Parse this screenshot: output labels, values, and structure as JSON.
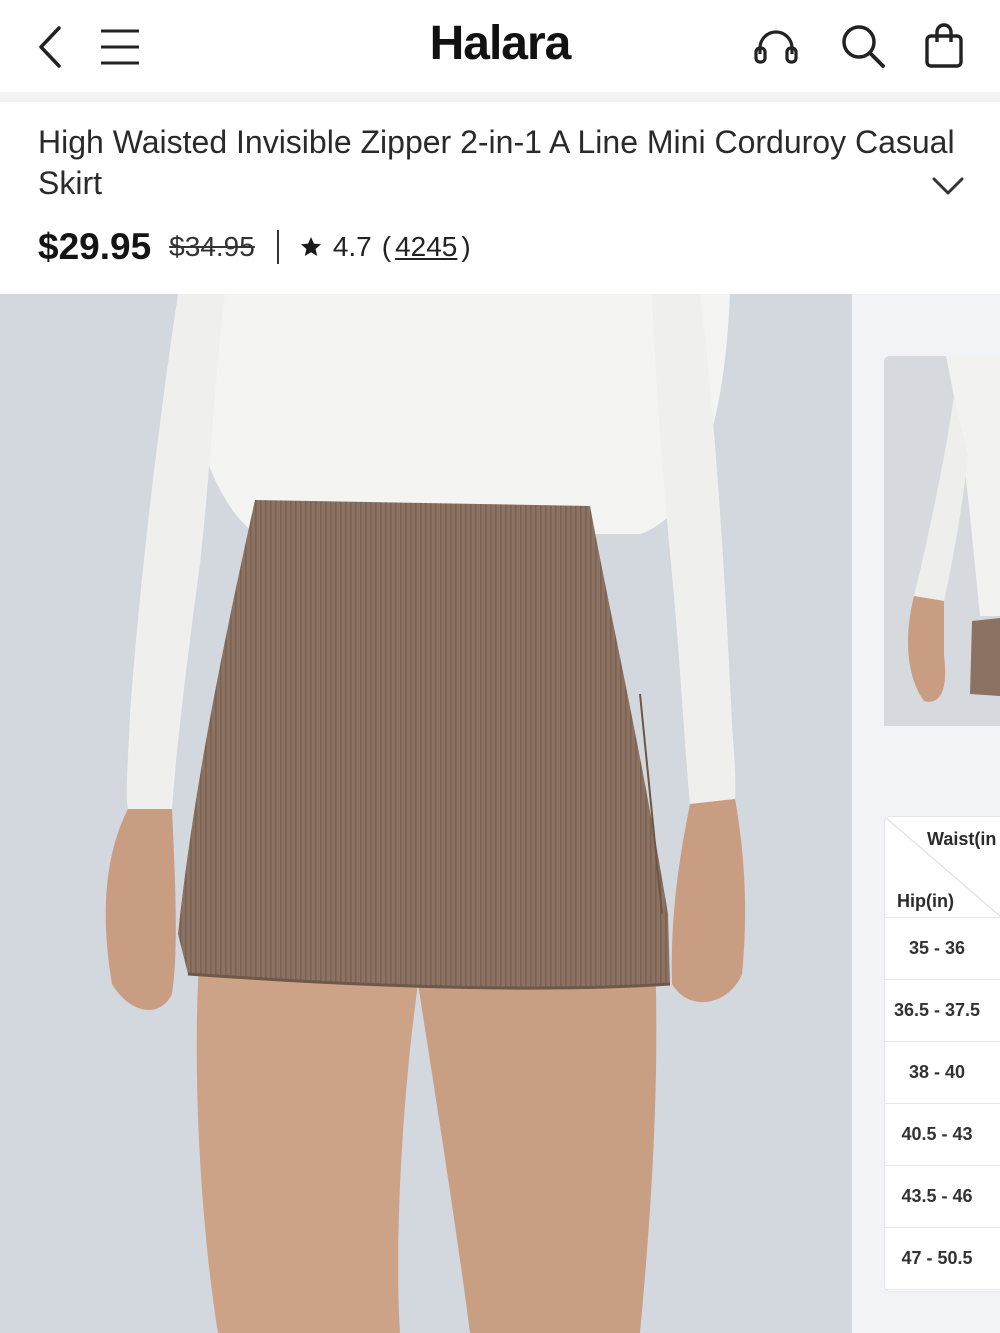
{
  "header": {
    "brand": "Halara",
    "icons": [
      "back-icon",
      "menu-icon",
      "headset-icon",
      "search-icon",
      "shopping-bag-icon"
    ]
  },
  "product": {
    "title": "High Waisted Invisible Zipper 2-in-1 A Line Mini Corduroy Casual Skirt",
    "price": "$29.95",
    "original_price": "$34.95",
    "rating": "4.7",
    "review_count": "4245",
    "paren_open": "(",
    "paren_close": ")"
  },
  "size_chart": {
    "col_header": "Waist(in",
    "row_header": "Hip(in)",
    "rows": [
      "35 - 36",
      "36.5 - 37.5",
      "38 - 40",
      "40.5 - 43",
      "43.5 - 46",
      "47 - 50.5"
    ]
  },
  "colors": {
    "skirt": "#8a7160",
    "top": "#f4f4f2",
    "skin": "#cfa58c",
    "background": "#d3d7de"
  }
}
